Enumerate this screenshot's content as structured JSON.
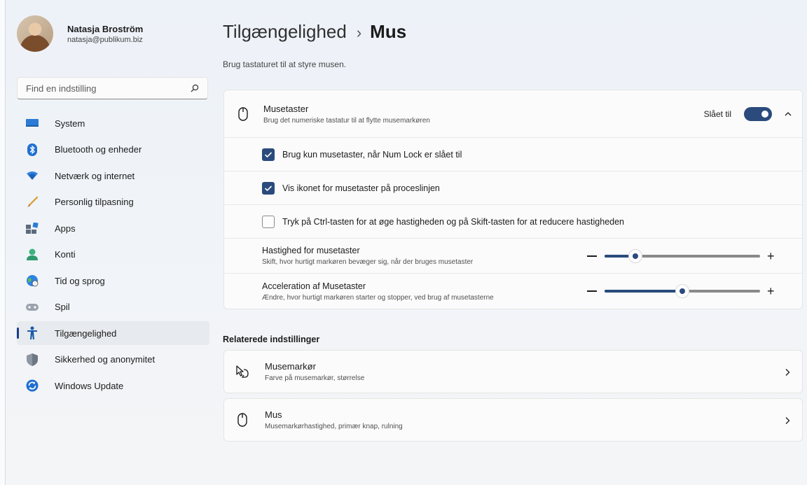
{
  "profile": {
    "name": "Natasja Broström",
    "email": "natasja@publikum.biz"
  },
  "search": {
    "placeholder": "Find en indstilling"
  },
  "sidebar": {
    "items": [
      {
        "label": "System",
        "icon": "system-icon"
      },
      {
        "label": "Bluetooth og enheder",
        "icon": "bluetooth-icon"
      },
      {
        "label": "Netværk og internet",
        "icon": "wifi-icon"
      },
      {
        "label": "Personlig tilpasning",
        "icon": "brush-icon"
      },
      {
        "label": "Apps",
        "icon": "apps-icon"
      },
      {
        "label": "Konti",
        "icon": "person-icon"
      },
      {
        "label": "Tid og sprog",
        "icon": "globe-clock-icon"
      },
      {
        "label": "Spil",
        "icon": "gamepad-icon"
      },
      {
        "label": "Tilgængelighed",
        "icon": "accessibility-icon",
        "active": true
      },
      {
        "label": "Sikkerhed og anonymitet",
        "icon": "shield-icon"
      },
      {
        "label": "Windows Update",
        "icon": "update-icon"
      }
    ]
  },
  "header": {
    "parent": "Tilgængelighed",
    "separator": "›",
    "current": "Mus",
    "subtitle": "Brug tastaturet til at styre musen."
  },
  "mouse_keys": {
    "title": "Musetaster",
    "description": "Brug det numeriske tastatur til at flytte musemarkøren",
    "toggle_label": "Slået til",
    "toggle_on": true,
    "options": [
      {
        "label": "Brug kun musetaster, når Num Lock er slået til",
        "checked": true
      },
      {
        "label": "Vis ikonet for musetaster på proceslinjen",
        "checked": true
      },
      {
        "label": "Tryk på Ctrl-tasten for at øge hastigheden og på Skift-tasten for at reducere hastigheden",
        "checked": false
      }
    ],
    "sliders": [
      {
        "title": "Hastighed for musetaster",
        "description": "Skift, hvor hurtigt markøren bevæger sig, når der bruges musetaster",
        "value_fraction": 0.2
      },
      {
        "title": "Acceleration af Musetaster",
        "description": "Ændre, hvor hurtigt markøren starter og stopper, ved brug af musetasterne",
        "value_fraction": 0.5
      }
    ]
  },
  "related": {
    "title": "Relaterede indstillinger",
    "items": [
      {
        "title": "Musemarkør",
        "description": "Farve på musemarkør, størrelse",
        "icon": "mouse-pointer-icon"
      },
      {
        "title": "Mus",
        "description": "Musemarkørhastighed, primær knap, rulning",
        "icon": "mouse-icon"
      }
    ]
  },
  "colors": {
    "accent": "#2a4b7c",
    "active_indicator": "#1b3f86"
  }
}
